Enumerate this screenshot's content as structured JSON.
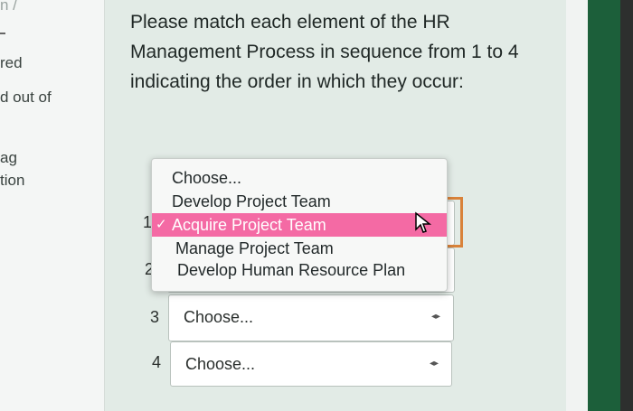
{
  "sidebar": {
    "top_fragment": "n /",
    "items": [
      {
        "label": "red"
      },
      {
        "label": "d out of"
      },
      {
        "label": "ag"
      },
      {
        "label": "tion"
      }
    ]
  },
  "question": {
    "text": "Please match each element of the HR Management Process in sequence from 1 to 4 indicating the order in which they occur:"
  },
  "dropdown": {
    "options": [
      {
        "label": "Choose...",
        "selected": false
      },
      {
        "label": "Develop Project Team",
        "selected": false
      },
      {
        "label": "Acquire Project Team",
        "selected": true
      },
      {
        "label": "Manage Project Team",
        "selected": false
      },
      {
        "label": "Develop Human Resource Plan",
        "selected": false
      }
    ],
    "check_glyph": "✓"
  },
  "rows": [
    {
      "number": "1"
    },
    {
      "number": "2"
    },
    {
      "number": "3",
      "value": "Choose..."
    },
    {
      "number": "4",
      "value": "Choose..."
    }
  ],
  "colors": {
    "selection": "#f46aa4",
    "highlight_border": "#d9823a",
    "edge": "#1c5f3a"
  }
}
